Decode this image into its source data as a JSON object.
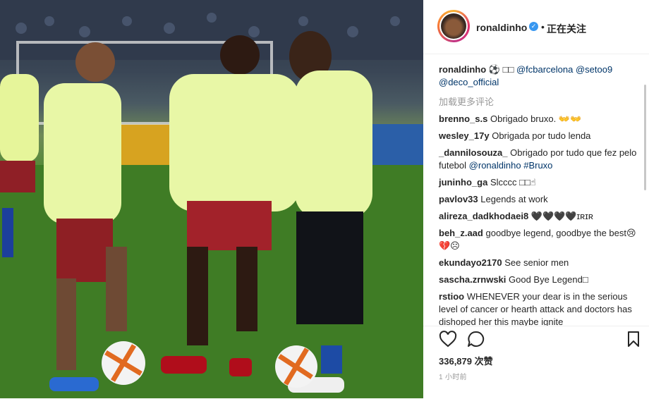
{
  "post": {
    "photo_alt": "",
    "header": {
      "username": "ronaldinho",
      "separator": "•",
      "follow_status": "正在关注"
    },
    "caption": {
      "username": "ronaldinho",
      "emoji": "⚽ □□",
      "mentions": [
        "@fcbarcelona",
        "@setoo9",
        "@deco_official"
      ]
    },
    "load_more": "加载更多评论",
    "comments": [
      {
        "user": "brenno_s.s",
        "text": "Obrigado bruxo. 👐👐"
      },
      {
        "user": "wesley_17y",
        "text": "Obrigada por tudo lenda"
      },
      {
        "user": "_dannilosouza_",
        "text": "Obrigado por tudo que fez pelo futebol",
        "mentions": [
          "@ronaldinho",
          "#Bruxo"
        ]
      },
      {
        "user": "juninho_ga",
        "text": "Slcccc □□☝"
      },
      {
        "user": "pavlov33",
        "text": "Legends at work"
      },
      {
        "user": "alireza_dadkhodaei8",
        "text": "🖤🖤🖤🖤ɪʀɪʀ"
      },
      {
        "user": "beh_z.aad",
        "text": "goodbye legend, goodbye the best😢💔☹"
      },
      {
        "user": "ekundayo2170",
        "text": "See senior men"
      },
      {
        "user": "sascha.zrnwski",
        "text": "Good Bye Legend□"
      },
      {
        "user": "rstioo",
        "text": "WHENEVER your dear is in the serious level of cancer or hearth attack and doctors has dishoped her this maybe ignite"
      }
    ],
    "likes": "336,879 次赞",
    "time": "1 小时前",
    "icons": [
      "heart-icon",
      "comment-icon",
      "bookmark-icon",
      "verified-badge-icon"
    ],
    "colors": {
      "link": "#003569",
      "verified": "#3897f0",
      "muted": "#999999",
      "text": "#262626"
    }
  }
}
